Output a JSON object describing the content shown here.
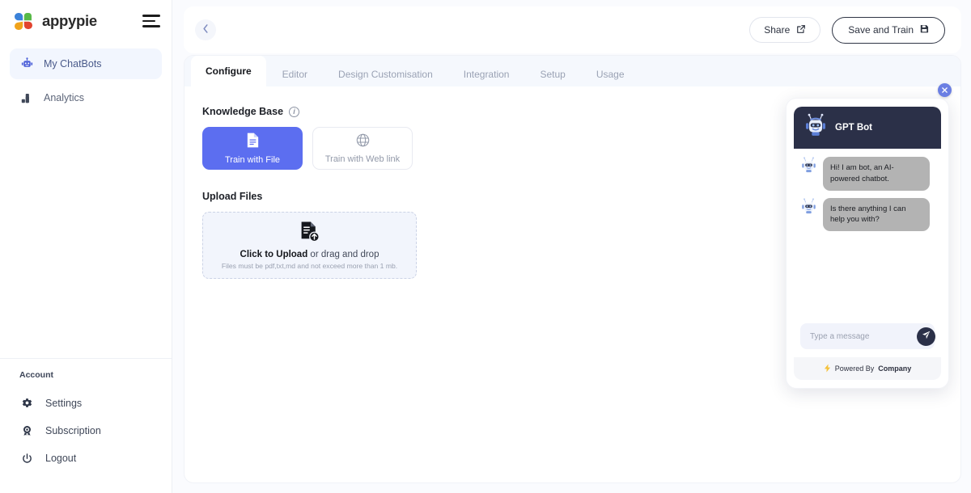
{
  "brand": {
    "name": "appypie",
    "logo_icon": "appypie-flower-logo",
    "menu_icon": "hamburger-icon"
  },
  "sidebar": {
    "items": [
      {
        "label": "My ChatBots",
        "icon": "robot-icon",
        "active": true
      },
      {
        "label": "Analytics",
        "icon": "bar-chart-icon",
        "active": false
      }
    ],
    "account_label": "Account",
    "account_items": [
      {
        "label": "Settings",
        "icon": "gear-icon"
      },
      {
        "label": "Subscription",
        "icon": "medal-icon"
      },
      {
        "label": "Logout",
        "icon": "power-icon"
      }
    ]
  },
  "topbar": {
    "back_icon": "chevron-left-icon",
    "share_label": "Share",
    "share_icon": "external-link-icon",
    "save_label": "Save and Train",
    "save_icon": "save-disk-icon"
  },
  "tabs": [
    {
      "label": "Configure",
      "active": true
    },
    {
      "label": "Editor",
      "active": false
    },
    {
      "label": "Design Customisation",
      "active": false
    },
    {
      "label": "Integration",
      "active": false
    },
    {
      "label": "Setup",
      "active": false
    },
    {
      "label": "Usage",
      "active": false
    }
  ],
  "knowledge_base": {
    "title": "Knowledge Base",
    "info_icon": "info-icon",
    "options": [
      {
        "label": "Train with File",
        "icon": "document-icon",
        "selected": true
      },
      {
        "label": "Train with Web link",
        "icon": "globe-icon",
        "selected": false
      }
    ]
  },
  "upload": {
    "title": "Upload Files",
    "icon": "file-upload-icon",
    "cta_strong": "Click to Upload",
    "cta_rest": " or drag and drop",
    "hint": "Files must be pdf,txt,md and not exceed more than 1 mb."
  },
  "chat_widget": {
    "close_icon": "close-icon",
    "bot_name": "GPT Bot",
    "avatar_icon": "robot-avatar-icon",
    "messages": [
      {
        "text": "Hi! I am bot, an AI-powered chatbot.",
        "from": "bot"
      },
      {
        "text": "Is there anything I can help you with?",
        "from": "bot"
      }
    ],
    "input_placeholder": "Type a message",
    "input_value": "",
    "send_icon": "send-plane-icon",
    "footer_icon": "lightning-icon",
    "footer_prefix": "Powered By ",
    "footer_brand": "Company"
  },
  "colors": {
    "accent_blue": "#5c6ef0",
    "chat_dark": "#2b3048",
    "close_blue": "#6b7fe3",
    "tabbar_bg": "#f5f8fd"
  }
}
